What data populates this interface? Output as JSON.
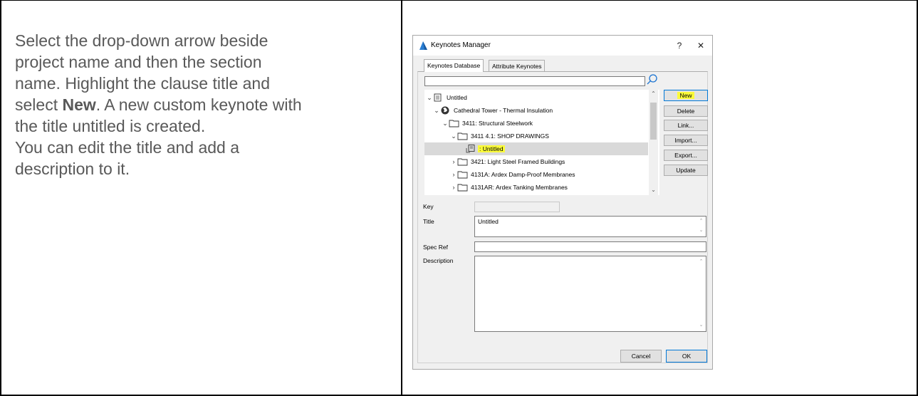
{
  "instructions": {
    "line1": "Select the drop-down arrow beside",
    "line2": "project name and then the section",
    "line3": "name. Highlight the clause title and",
    "line4_pre": "select ",
    "line4_bold": "New",
    "line4_post": ". A new custom keynote with",
    "line5": "the title untitled is created.",
    "line6": "You can edit the title and add a",
    "line7": "description to it."
  },
  "dialog": {
    "title": "Keynotes Manager",
    "help_label": "?",
    "close_label": "✕",
    "tabs": [
      "Keynotes Database",
      "Attribute Keynotes"
    ],
    "search": {
      "value": "",
      "placeholder": ""
    },
    "tree": [
      {
        "label": "Untitled"
      },
      {
        "label": "Cathedral Tower - Thermal Insulation"
      },
      {
        "label": "3411: Structural Steelwork"
      },
      {
        "label": "3411 4.1: SHOP DRAWINGS"
      },
      {
        "label": ": Untitled"
      },
      {
        "label": "3421: Light Steel Framed Buildings"
      },
      {
        "label": "4131A: Ardex Damp-Proof Membranes"
      },
      {
        "label": "4131AR: Ardex Tanking Membranes"
      }
    ],
    "buttons": {
      "new": "New",
      "delete": "Delete",
      "link": "Link...",
      "import": "Import...",
      "export": "Export...",
      "update": "Update",
      "cancel": "Cancel",
      "ok": "OK"
    },
    "fields": {
      "key_label": "Key",
      "key_value": "",
      "title_label": "Title",
      "title_value": "Untitled",
      "specref_label": "Spec Ref",
      "specref_value": "",
      "description_label": "Description",
      "description_value": ""
    },
    "colors": {
      "highlight": "#fbfb3a",
      "focus_border": "#0078d7"
    }
  }
}
